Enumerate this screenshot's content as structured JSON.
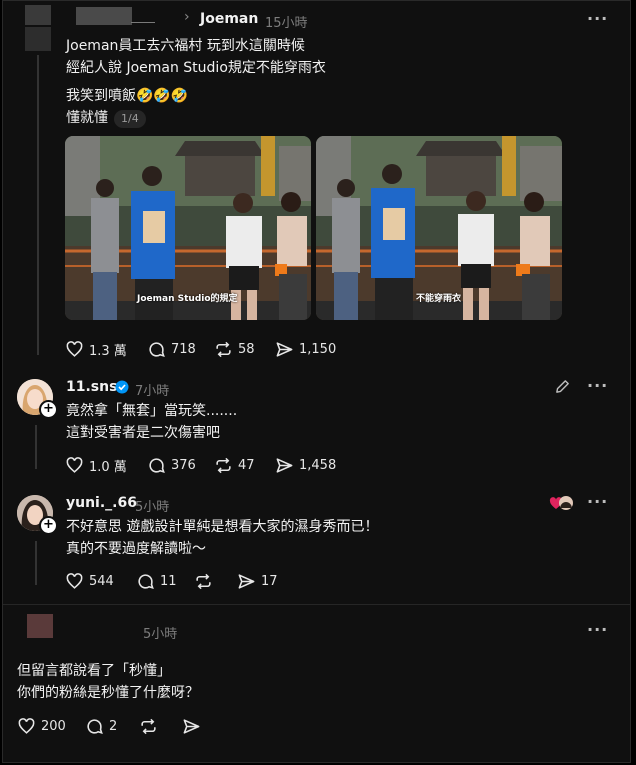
{
  "post1": {
    "author": "Joeman",
    "time": "15小時",
    "line1": "Joeman員工去六福村 玩到水這關時候",
    "line2": "經紀人說 Joeman Studio規定不能穿雨衣",
    "line3": "我笑到噴飯🤣🤣🤣",
    "line4": "懂就懂",
    "page_indicator": "1/4",
    "image1_caption": "Joeman Studio的規定",
    "image2_caption": "不能穿雨衣",
    "likes": "1.3 萬",
    "comments": "718",
    "reposts": "58",
    "shares": "1,150"
  },
  "reply1": {
    "author": "11.sns",
    "time": "7小時",
    "line1": "竟然拿「無套」當玩笑.......",
    "line2": "這對受害者是二次傷害吧",
    "likes": "1.0 萬",
    "comments": "376",
    "reposts": "47",
    "shares": "1,458"
  },
  "reply2": {
    "author": "yuni._.66",
    "time": "5小時",
    "line1": "不好意思 遊戲設計單純是想看大家的濕身秀而已！",
    "line2": "真的不要過度解讀啦～",
    "likes": "544",
    "comments": "11",
    "shares": "17"
  },
  "post2": {
    "time": "5小時",
    "line1": "但留言都說看了「秒懂」",
    "line2": "你們的粉絲是秒懂了什麼呀？",
    "likes": "200",
    "comments": "2"
  },
  "icons": [
    "more-icon",
    "heart-icon",
    "comment-icon",
    "repost-icon",
    "share-icon",
    "edit-icon",
    "verified-icon",
    "plus-icon"
  ],
  "colors": {
    "background": "#101010",
    "text": "#f2f2f2",
    "muted": "#7d7d7d",
    "verified": "#0095f6"
  }
}
